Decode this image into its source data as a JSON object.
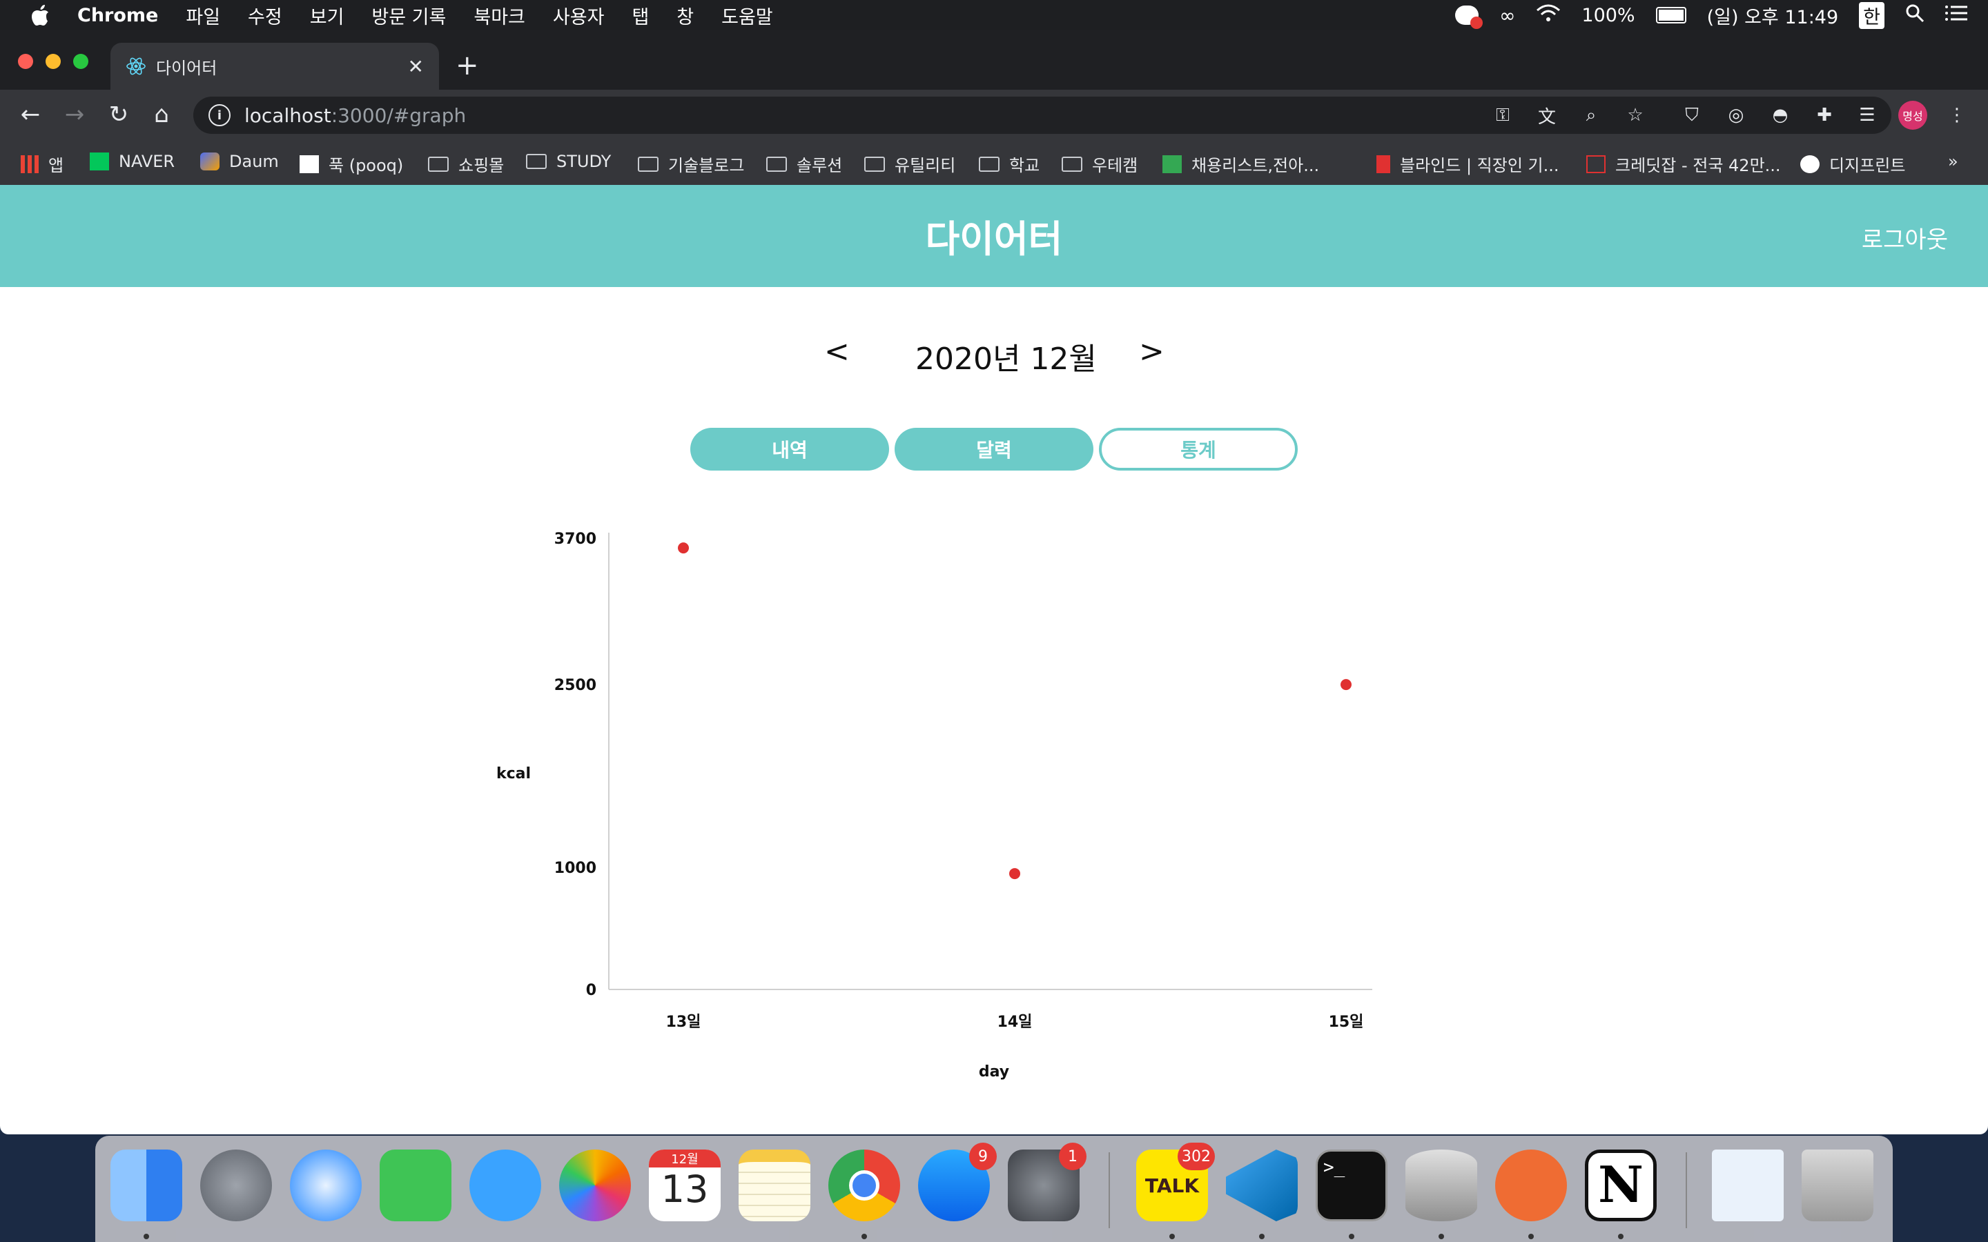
{
  "menubar": {
    "app": "Chrome",
    "items": [
      "파일",
      "수정",
      "보기",
      "방문 기록",
      "북마크",
      "사용자",
      "탭",
      "창",
      "도움말"
    ],
    "battery": "100%",
    "clock": "(일) 오후 11:49",
    "input_lang": "한"
  },
  "browser": {
    "tab_title": "다이어터",
    "url_host": "localhost",
    "url_rest": ":3000/#graph",
    "profile_label": "명성",
    "bookmarks": [
      "앱",
      "NAVER",
      "Daum",
      "푹 (pooq)",
      "쇼핑몰",
      "STUDY",
      "기술블로그",
      "솔루션",
      "유틸리티",
      "학교",
      "우테캠",
      "채용리스트,전아...",
      "블라인드 | 직장인 기...",
      "크레딧잡 - 전국 42만...",
      "디지프린트"
    ],
    "more": "»"
  },
  "app": {
    "title": "다이어터",
    "logout": "로그아웃",
    "prev": "<",
    "next": ">",
    "month": "2020년 12월",
    "tabs": [
      "내역",
      "달력",
      "통계"
    ]
  },
  "chart_data": {
    "type": "scatter",
    "xlabel": "day",
    "ylabel": "kcal",
    "categories": [
      "13일",
      "14일",
      "15일"
    ],
    "values": [
      3620,
      950,
      2500
    ],
    "yticks": [
      0,
      1000,
      2500,
      3700
    ],
    "ylim": [
      0,
      3700
    ],
    "grid": false,
    "point_color": "#e03131"
  },
  "dock": {
    "badges": {
      "appstore": "9",
      "settings": "1",
      "kakaotalk": "302"
    },
    "calendar_month": "12월",
    "calendar_day": "13",
    "kakao_label": "TALK"
  },
  "colors": {
    "accent": "#6ccbc8",
    "menubar": "#1e1f22",
    "browser": "#35363a"
  }
}
